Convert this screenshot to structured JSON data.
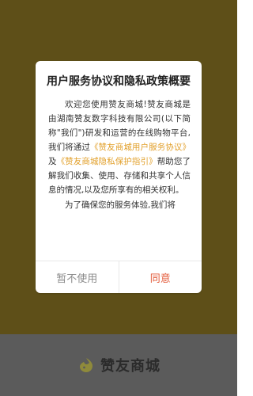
{
  "app": {
    "brand_name": "赞友商城"
  },
  "dialog": {
    "title": "用户服务协议和隐私政策概要",
    "paragraph_1_before_link_1": "欢迎您使用赞友商城!赞友商城是由湖南赞友数字科技有限公司(以下简称\"我们\")研发和运营的在线购物平台,我们将通过",
    "link_user_agreement": "《赞友商城用户服务协议》",
    "between_links": "及",
    "link_privacy_guide": "《赞友商城隐私保护指引》",
    "paragraph_1_after_links": "帮助您了解我们收集、使用、存储和共享个人信息的情况,以及您所享有的相关权利。",
    "paragraph_2_partial": "为了确保您的服务体验,我们将",
    "button_cancel": "暂不使用",
    "button_agree": "同意"
  },
  "colors": {
    "background": "#5e4f18",
    "bottom_bar": "#5b5b5b",
    "link": "#e2a02b",
    "agree": "#e35a3a",
    "cancel": "#8b8b8b"
  }
}
